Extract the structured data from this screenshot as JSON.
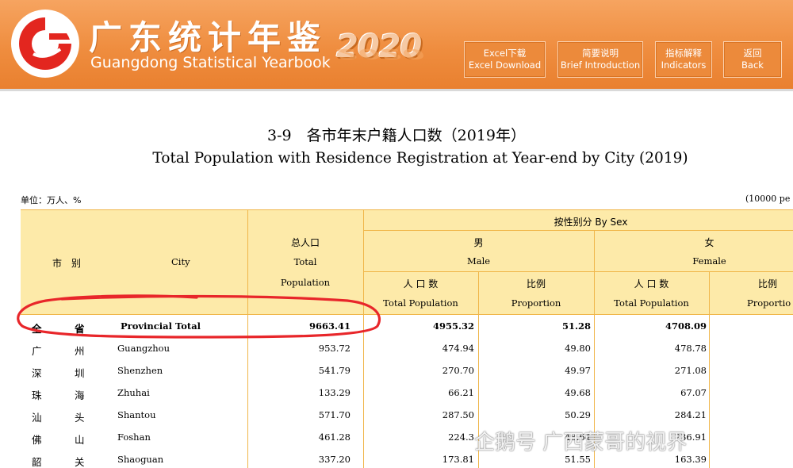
{
  "header": {
    "title_cn": "广东统计年鉴",
    "title_en": "Guangdong Statistical Yearbook",
    "year": "2020",
    "brand_color": "#ef8d3f",
    "nav": [
      {
        "line1": "Excel下载",
        "line2": "Excel Download"
      },
      {
        "line1": "简要说明",
        "line2": "Brief Introduction"
      },
      {
        "line1": "指标解释",
        "line2": "Indicators"
      },
      {
        "line1": "返回",
        "line2": "Back"
      }
    ]
  },
  "page": {
    "title_cn": "3-9　各市年末户籍人口数（2019年）",
    "title_en": "Total Population with Residence Registration at Year-end by City (2019)",
    "unit_left": "单位：万人、%",
    "unit_right": "(10000 pe"
  },
  "table": {
    "header": {
      "city_cn": "市　别",
      "city_en": "City",
      "total_cn": "总人口",
      "total_en1": "Total",
      "total_en2": "Population",
      "by_sex": "按性别分  By Sex",
      "male_cn": "男",
      "male_en": "Male",
      "female_cn": "女",
      "female_en": "Female",
      "pop_cn": "人 口 数",
      "pop_en": "Total Population",
      "prop_cn": "比例",
      "prop_en": "Proportion",
      "prop_cn_cut": "比例",
      "prop_en_cut": "Proportio"
    },
    "rows": [
      {
        "cn1": "全",
        "cn2": "省",
        "en": "Provincial Total",
        "total": "9663.41",
        "male": "4955.32",
        "male_pct": "51.28",
        "female": "4708.09",
        "bold": true
      },
      {
        "cn1": "广",
        "cn2": "州",
        "en": "Guangzhou",
        "total": "953.72",
        "male": "474.94",
        "male_pct": "49.80",
        "female": "478.78"
      },
      {
        "cn1": "深",
        "cn2": "圳",
        "en": "Shenzhen",
        "total": "541.79",
        "male": "270.70",
        "male_pct": "49.97",
        "female": "271.08"
      },
      {
        "cn1": "珠",
        "cn2": "海",
        "en": "Zhuhai",
        "total": "133.29",
        "male": "66.21",
        "male_pct": "49.68",
        "female": "67.07"
      },
      {
        "cn1": "汕",
        "cn2": "头",
        "en": "Shantou",
        "total": "571.70",
        "male": "287.50",
        "male_pct": "50.29",
        "female": "284.21"
      },
      {
        "cn1": "佛",
        "cn2": "山",
        "en": "Foshan",
        "total": "461.28",
        "male": "224.3",
        "male_pct": "48.64",
        "female": "236.91"
      },
      {
        "cn1": "韶",
        "cn2": "关",
        "en": "Shaoguan",
        "total": "337.20",
        "male": "173.81",
        "male_pct": "51.55",
        "female": "163.39"
      }
    ]
  },
  "watermark": "企鹅号 广西蒙哥的视界",
  "colors": {
    "header_fill": "#fdeaa9",
    "grid_line": "#f0b64a",
    "annotation": "#e8262a"
  }
}
